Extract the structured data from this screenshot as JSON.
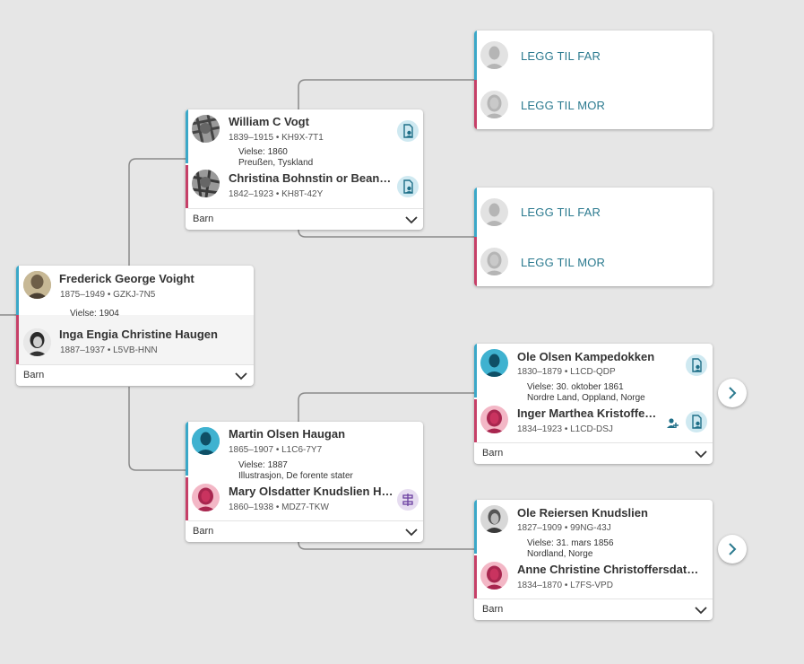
{
  "labels": {
    "children": "Barn",
    "add_father": "LEGG TIL FAR",
    "add_mother": "LEGG TIL MOR"
  },
  "colors": {
    "male_bar": "#3ba8c8",
    "female_bar": "#c64068",
    "background": "#e6e6e6",
    "link_text": "#2b7a8f"
  },
  "root": {
    "husband": {
      "name": "Frederick George Voight",
      "years": "1875–1949 •",
      "id": "GZKJ-7N5"
    },
    "marriage": {
      "line1": "Vielse: 1904",
      "line2": ""
    },
    "wife": {
      "name": "Inga Engia Christine Haugen",
      "years": "1887–1937 •",
      "id": "L5VB-HNN"
    }
  },
  "father_couple": {
    "husband": {
      "name": "William C Vogt",
      "years": "1839–1915 •",
      "id": "KH9X-7T1"
    },
    "marriage": {
      "line1": "Vielse: 1860",
      "line2": "Preußen, Tyskland"
    },
    "wife": {
      "name": "Christina Bohnstin or Bean…",
      "years": "1842–1923 •",
      "id": "KH8T-42Y"
    }
  },
  "mother_couple": {
    "husband": {
      "name": "Martin Olsen Haugan",
      "years": "1865–1907 •",
      "id": "L1C6-7Y7"
    },
    "marriage": {
      "line1": "Vielse: 1887",
      "line2": "Illustrasjon, De forente stater"
    },
    "wife": {
      "name": "Mary Olsdatter Knudslien H…",
      "years": "1860–1938 •",
      "id": "MDZ7-TKW"
    }
  },
  "martin_parents": {
    "husband": {
      "name": "Ole Olsen Kampedokken",
      "years": "1830–1879 •",
      "id": "L1CD-QDP"
    },
    "marriage": {
      "line1": "Vielse: 30. oktober 1861",
      "line2": "Nordre Land, Oppland, Norge"
    },
    "wife": {
      "name": "Inger Marthea Kristoffe…",
      "years": "1834–1923 •",
      "id": "L1CD-DSJ"
    }
  },
  "mary_parents": {
    "husband": {
      "name": "Ole Reiersen Knudslien",
      "years": "1827–1909 •",
      "id": "99NG-43J"
    },
    "marriage": {
      "line1": "Vielse: 31. mars 1856",
      "line2": "Nordland, Norge"
    },
    "wife": {
      "name": "Anne Christine Christoffersdat…",
      "years": "1834–1870 •",
      "id": "L7FS-VPD"
    }
  }
}
